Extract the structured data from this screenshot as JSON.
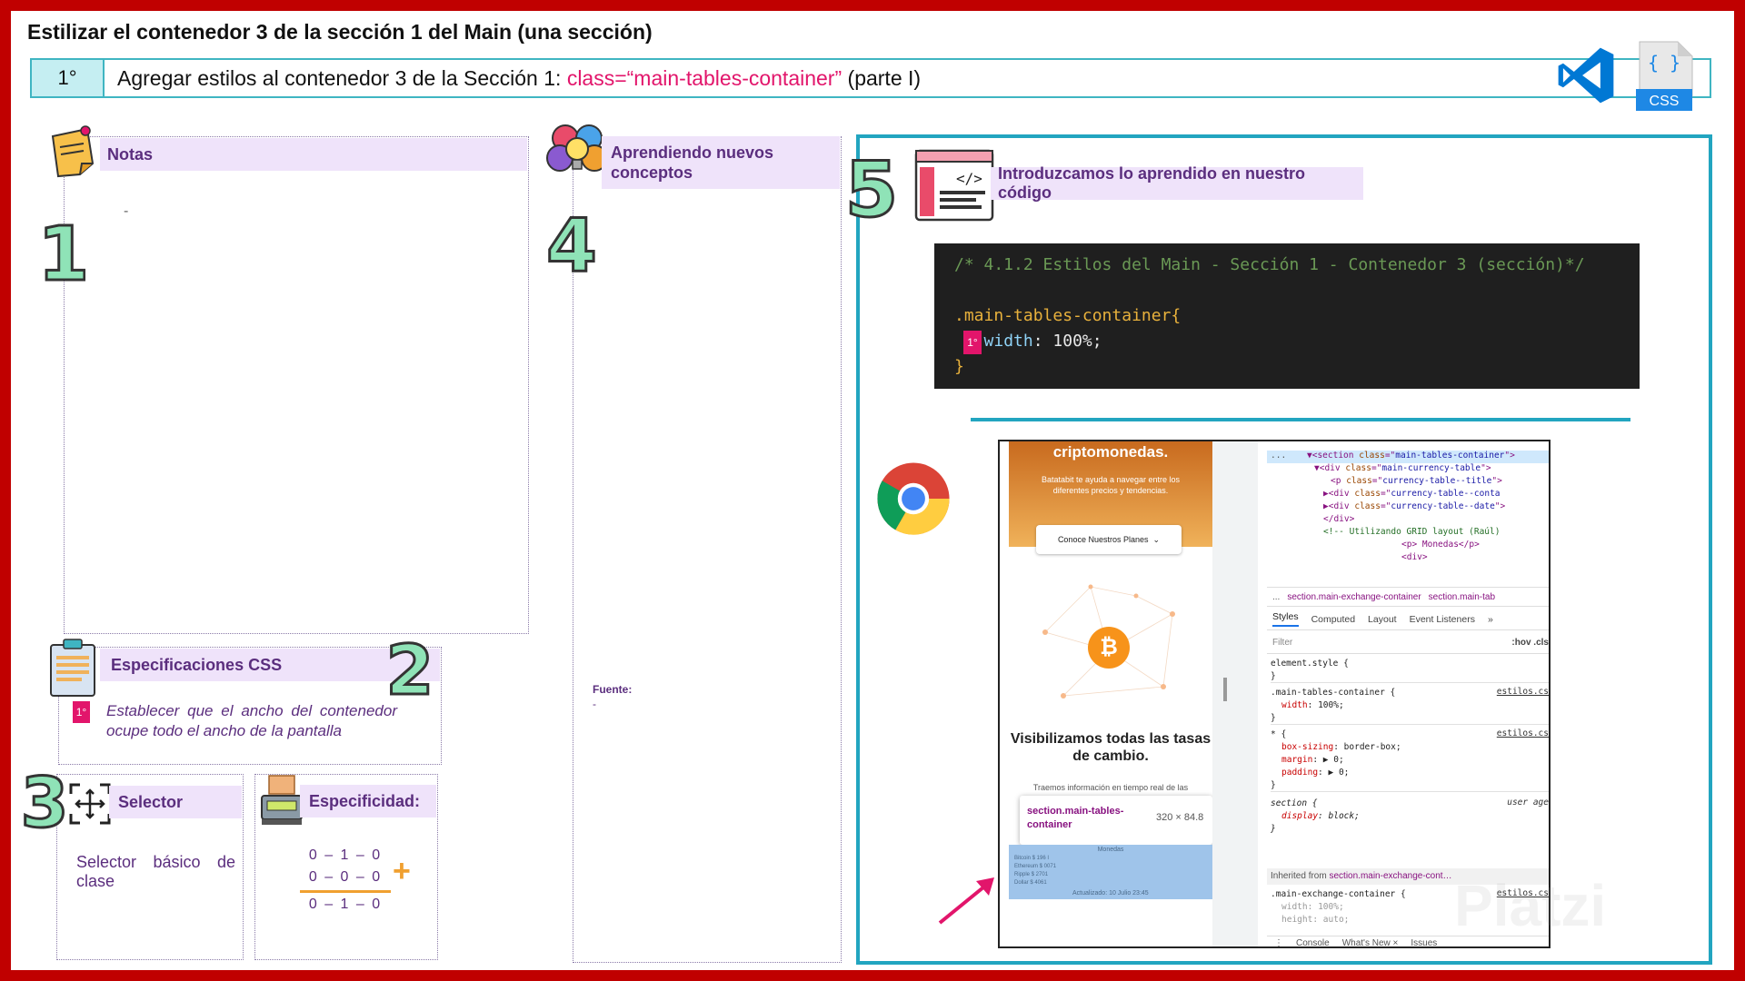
{
  "title": "Estilizar el contenedor 3 de la sección 1 del Main (una sección)",
  "step": {
    "number": "1°",
    "text": "Agregar estilos al contenedor 3 de la Sección 1: ",
    "class_text": "class=“main-tables-container”",
    "suffix": " (parte I)"
  },
  "logos": {
    "vscode": "vscode-logo-icon",
    "css": "CSS",
    "css_braces": "{ }"
  },
  "panel1": {
    "number": "1",
    "header": "Notas",
    "content": "-"
  },
  "panel2": {
    "number": "2",
    "header": "Especificaciones CSS",
    "badge": "1°",
    "text": "Establecer que el ancho del contenedor ocupe todo el ancho de la pantalla"
  },
  "panel3": {
    "number": "3",
    "selector_header": "Selector",
    "selector_text_line1": "Selector básico de",
    "selector_text_line2": "clase",
    "specificity_header": "Especificidad:",
    "specificity_rows": [
      "0 – 1 – 0",
      "0 – 0 – 0",
      "0 – 1 – 0"
    ],
    "plus": "+"
  },
  "panel4": {
    "number": "4",
    "header": "Aprendiendo nuevos conceptos",
    "fuente_label": "Fuente:",
    "fuente_value": "-"
  },
  "panel5": {
    "number": "5",
    "header": "Introduzcamos lo aprendido en nuestro código",
    "code": {
      "comment": "/* 4.1.2 Estilos del Main - Sección 1 - Contenedor 3 (sección)*/",
      "selector": ".main-tables-container{",
      "badge": "1°",
      "property": "width",
      "value": "100%;",
      "close": "}"
    }
  },
  "browser": {
    "hero_title": "criptomonedas.",
    "hero_sub": "Batatabit te ayuda a navegar entre los diferentes precios y tendencias.",
    "hero_button": "Conoce Nuestros Planes",
    "btc_symbol": "₿",
    "vis_title": "Visibilizamos todas las tasas de cambio.",
    "vis_sub": "Traemos información en tiempo real de las",
    "tooltip_name": "section.main-tables-container",
    "tooltip_size": "320 × 84.8",
    "highlight_title": "Monedas",
    "highlight_rows": [
      "Bitcoin  $ 196 I",
      "Ethereum $ 0071",
      "Ripple   $ 2701",
      "Dollar   $ 4061"
    ],
    "highlight_footer": "Actualizado: 10 Julio 23:45",
    "dom": [
      {
        "indent": 2,
        "tag": "▼<section",
        "attr": "class",
        "val": "main-tables-container",
        "close": ">"
      },
      {
        "indent": 3,
        "tag": "▼<div",
        "attr": "class",
        "val": "main-currency-table",
        "close": ">"
      },
      {
        "indent": 4,
        "tag": "<p",
        "attr": "class",
        "val": "currency-table--title",
        "close": ">"
      },
      {
        "indent": 4,
        "tag": "▶<div",
        "attr": "class",
        "val": "currency-table--conta",
        "close": ""
      },
      {
        "indent": 4,
        "tag": "▶<div",
        "attr": "class",
        "val": "currency-table--date",
        "close": ">"
      },
      {
        "indent": 3,
        "tag": "</div>",
        "attr": "",
        "val": "",
        "close": ""
      }
    ],
    "dom_comment": "<!-- Utilizando GRID layout (Raúl)",
    "dom_p": "<p> Monedas</p>",
    "dom_div": "<div>",
    "dom_ellipsis": "...",
    "crumbs": [
      "...",
      "section.main-exchange-container",
      "section.main-tab"
    ],
    "tabs": [
      "Styles",
      "Computed",
      "Layout",
      "Event Listeners",
      "»"
    ],
    "filter": "Filter",
    "filter_right": ":hov  .cls",
    "rules": [
      {
        "selector": "element.style {",
        "src": "",
        "props": [],
        "close": "}"
      },
      {
        "selector": ".main-tables-container {",
        "src": "estilos.cs",
        "props": [
          [
            "width",
            "100%;"
          ]
        ],
        "close": "}"
      },
      {
        "selector": "* {",
        "src": "estilos.cs",
        "props": [
          [
            "box-sizing",
            "border-box;"
          ],
          [
            "margin",
            "▶ 0;"
          ],
          [
            "padding",
            "▶ 0;"
          ]
        ],
        "close": "}"
      },
      {
        "selector": "section {",
        "src": "user age",
        "props": [
          [
            "display",
            "block;"
          ]
        ],
        "close": "}"
      }
    ],
    "inherited_label": "Inherited from ",
    "inherited_sel": "section.main-exchange-cont…",
    "last_rule": {
      "selector": ".main-exchange-container {",
      "src": "estilos.cs",
      "props": [
        [
          "width",
          "100%;"
        ],
        [
          "height",
          "auto;"
        ]
      ]
    },
    "console_tabs": [
      "⋮",
      "Console",
      "What's New ×",
      "Issues"
    ]
  },
  "watermark": "Platzi",
  "colors": {
    "frame": "#c00000",
    "accent_teal": "#22a5c0",
    "pink": "#e2156b",
    "purple": "#5b2e7e",
    "header_bg": "#efe3fa"
  }
}
